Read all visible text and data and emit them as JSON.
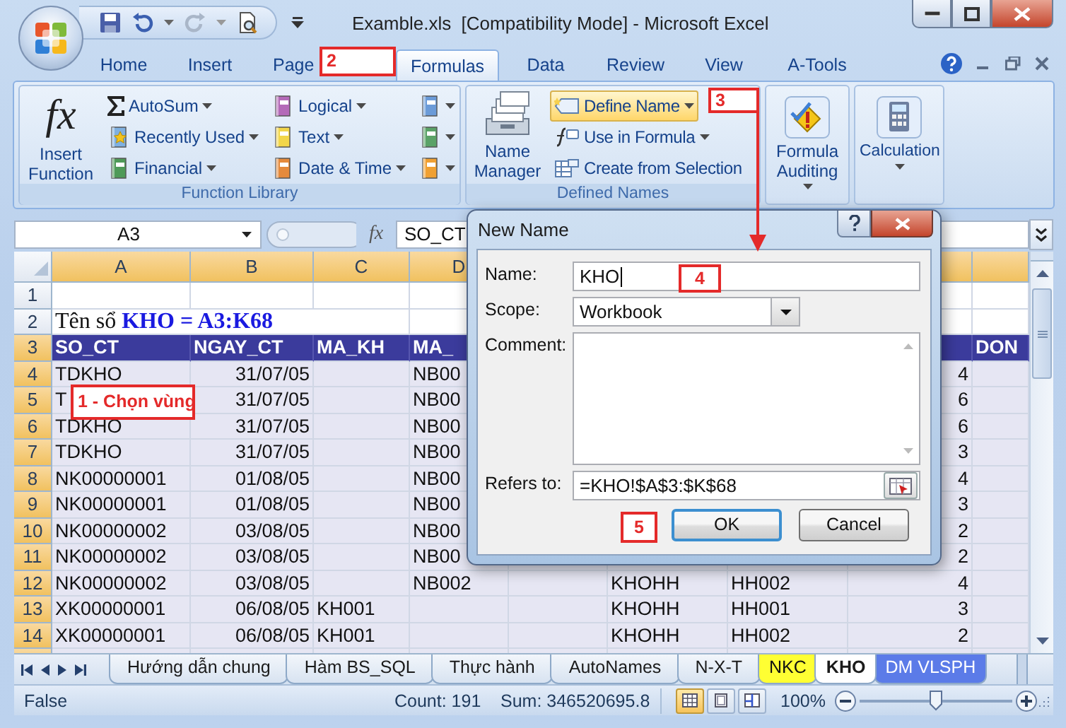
{
  "window": {
    "title": "Examble.xls  [Compatibility Mode] - Microsoft Excel"
  },
  "ribbon_tabs": [
    {
      "label": "Home",
      "selected": false
    },
    {
      "label": "Insert",
      "selected": false
    },
    {
      "label": "Page",
      "selected": false
    },
    {
      "label": "Formulas",
      "selected": true
    },
    {
      "label": "Data",
      "selected": false
    },
    {
      "label": "Review",
      "selected": false
    },
    {
      "label": "View",
      "selected": false
    },
    {
      "label": "A-Tools",
      "selected": false
    }
  ],
  "ribbon_groups": [
    {
      "kind": "library",
      "label": "Function Library",
      "big_buttons": [
        {
          "icon_text": "fx",
          "label": "Insert Function"
        }
      ],
      "columns": [
        [
          {
            "label": "AutoSum",
            "dropdown": true
          },
          {
            "label": "Recently Used",
            "dropdown": true
          },
          {
            "label": "Financial",
            "dropdown": true
          }
        ],
        [
          {
            "label": "Logical",
            "dropdown": true
          },
          {
            "label": "Text",
            "dropdown": true
          },
          {
            "label": "Date & Time",
            "dropdown": true
          }
        ],
        [
          {
            "dropdown": true
          },
          {
            "dropdown": true
          },
          {
            "dropdown": true
          }
        ]
      ]
    },
    {
      "kind": "names",
      "label": "Defined Names",
      "big_buttons": [
        {
          "label": "Name Manager"
        }
      ],
      "columns": [
        [
          {
            "label": "Define Name",
            "dropdown": true,
            "highlighted": true
          },
          {
            "label": "Use in Formula",
            "dropdown": true,
            "highlighted": false
          },
          {
            "label": "Create from Selection",
            "dropdown": false,
            "highlighted": false
          }
        ]
      ]
    },
    {
      "kind": "auditing",
      "big_buttons": [
        {
          "label": "Formula Auditing",
          "dropdown": true
        }
      ]
    },
    {
      "kind": "calculation",
      "big_buttons": [
        {
          "label": "Calculation",
          "dropdown": true
        }
      ]
    }
  ],
  "formula_bar": {
    "name_box": "A3",
    "function_icon": "fx",
    "content": "SO_CT"
  },
  "sheet": {
    "column_headers": {
      "A": {
        "label": "A",
        "selected": true
      },
      "B": {
        "label": "B",
        "selected": true
      },
      "C": {
        "label": "C",
        "selected": true
      },
      "D": {
        "label": "D",
        "selected": true
      },
      "H": {
        "selected": true
      },
      "I": {
        "selected": true
      }
    },
    "rows": [
      {
        "number": "1",
        "kind": "blank",
        "selected": false
      },
      {
        "number": "2",
        "kind": "title",
        "selected": false,
        "cells": {
          "A": "Tên sổ **KHO = A3:K68**"
        }
      },
      {
        "number": "3",
        "kind": "header",
        "selected": true,
        "cells": {
          "A": "SO_CT",
          "B": "NGAY_CT",
          "C": "MA_KH",
          "D": "MA_",
          "I": "DON"
        }
      },
      {
        "number": "4",
        "kind": "data",
        "selected": true,
        "cells": {
          "A": "TDKHO",
          "B": "31/07/05",
          "D": "NB00",
          "H": "4"
        }
      },
      {
        "number": "5",
        "kind": "data",
        "selected": true,
        "cells": {
          "A": "T",
          "B": "31/07/05",
          "D": "NB00",
          "H": "6"
        }
      },
      {
        "number": "6",
        "kind": "data",
        "selected": true,
        "cells": {
          "A": "TDKHO",
          "B": "31/07/05",
          "D": "NB00",
          "H": "6"
        }
      },
      {
        "number": "7",
        "kind": "data",
        "selected": true,
        "cells": {
          "A": "TDKHO",
          "B": "31/07/05",
          "D": "NB00",
          "H": "3"
        }
      },
      {
        "number": "8",
        "kind": "data",
        "selected": true,
        "cells": {
          "A": "NK00000001",
          "B": "01/08/05",
          "D": "NB00",
          "H": "4"
        }
      },
      {
        "number": "9",
        "kind": "data",
        "selected": true,
        "cells": {
          "A": "NK00000001",
          "B": "01/08/05",
          "D": "NB00",
          "H": "3"
        }
      },
      {
        "number": "10",
        "kind": "data",
        "selected": true,
        "cells": {
          "A": "NK00000002",
          "B": "03/08/05",
          "D": "NB00",
          "H": "2"
        }
      },
      {
        "number": "11",
        "kind": "data",
        "selected": true,
        "cells": {
          "A": "NK00000002",
          "B": "03/08/05",
          "D": "NB00",
          "H": "2"
        }
      },
      {
        "number": "12",
        "kind": "data",
        "selected": true,
        "cells": {
          "A": "NK00000002",
          "B": "03/08/05",
          "D": "NB002",
          "F": "KHOHH",
          "G": "HH002",
          "H": "4"
        }
      },
      {
        "number": "13",
        "kind": "data",
        "selected": true,
        "cells": {
          "A": "XK00000001",
          "B": "06/08/05",
          "C": "KH001",
          "F": "KHOHH",
          "G": "HH001",
          "H": "3"
        }
      },
      {
        "number": "14",
        "kind": "data",
        "selected": true,
        "cells": {
          "A": "XK00000001",
          "B": "06/08/05",
          "C": "KH001",
          "F": "KHOHH",
          "G": "HH002",
          "H": "2"
        }
      }
    ]
  },
  "dialog": {
    "title": "New Name",
    "fields": [
      {
        "kind": "text",
        "label": "Name:",
        "value": "KHO"
      },
      {
        "kind": "select",
        "label": "Scope:",
        "value": "Workbook"
      },
      {
        "kind": "textarea",
        "label": "Comment:"
      },
      {
        "kind": "reference",
        "label": "Refers to:",
        "value": "=KHO!$A$3:$K$68"
      }
    ],
    "buttons": [
      {
        "label": "OK",
        "default": true
      },
      {
        "label": "Cancel",
        "default": false
      }
    ]
  },
  "annotations": [
    {
      "label": "1 - Chọn vùng"
    },
    {
      "label": "2"
    },
    {
      "label": "3"
    },
    {
      "label": "4"
    },
    {
      "label": "5"
    }
  ],
  "sheet_tabs": [
    {
      "label": "Hướng dẫn chung",
      "selected": false
    },
    {
      "label": "Hàm BS_SQL",
      "selected": false
    },
    {
      "label": "Thực hành",
      "selected": false
    },
    {
      "label": "AutoNames",
      "selected": false
    },
    {
      "label": "N-X-T",
      "selected": false
    },
    {
      "label": "NKC",
      "selected": false,
      "color": "#ffff33"
    },
    {
      "label": "KHO",
      "selected": true
    },
    {
      "label": "DM VLSPH",
      "selected": false,
      "color": "#5b7be8"
    }
  ],
  "status_bar": {
    "mode": "False",
    "count": "Count: 191",
    "sum": "Sum: 346520695.8",
    "views": [
      {
        "selected": true
      },
      {
        "selected": false
      },
      {
        "selected": false
      }
    ],
    "zoom": "100%",
    "zoom_slider": {
      "level": 0.5
    }
  }
}
